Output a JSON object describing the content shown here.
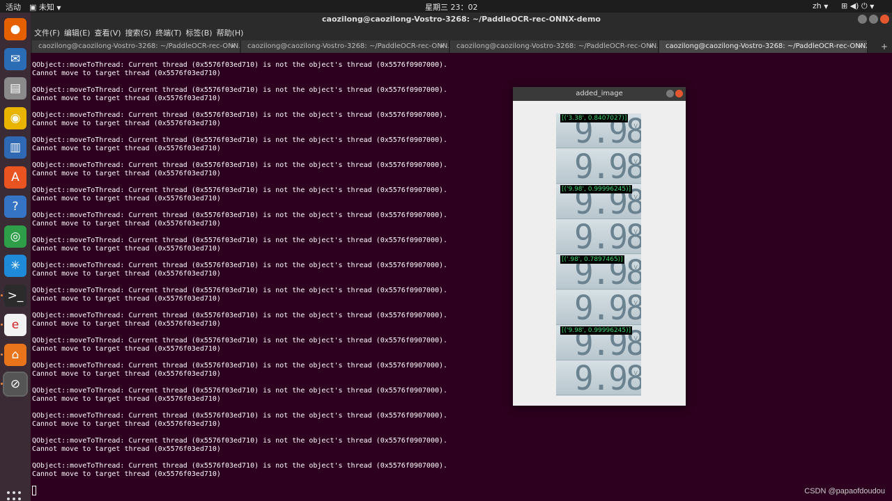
{
  "topbar": {
    "activities": "活动",
    "app_menu": "未知",
    "clock": "星期三 23：02",
    "lang": "zh"
  },
  "window": {
    "title": "caozilong@caozilong-Vostro-3268: ~/PaddleOCR-rec-ONNX-demo"
  },
  "menubar": [
    "文件(F)",
    "编辑(E)",
    "查看(V)",
    "搜索(S)",
    "终端(T)",
    "标签(B)",
    "帮助(H)"
  ],
  "tabs": [
    {
      "label": "caozilong@caozilong-Vostro-3268: ~/PaddleOCR-rec-ONN..."
    },
    {
      "label": "caozilong@caozilong-Vostro-3268: ~/PaddleOCR-rec-ONN..."
    },
    {
      "label": "caozilong@caozilong-Vostro-3268: ~/PaddleOCR-rec-ONN..."
    },
    {
      "label": "caozilong@caozilong-Vostro-3268: ~/PaddleOCR-rec-ONNX..."
    }
  ],
  "terminal": {
    "line1": "QObject::moveToThread: Current thread (0x5576f03ed710) is not the object's thread (0x5576f0907000).",
    "line2": "Cannot move to target thread (0x5576f03ed710)",
    "repeat_count": 17
  },
  "popup": {
    "title": "added_image",
    "strips": [
      {
        "digits": "9.98",
        "unit": "V",
        "label": "[('3.38', 0.8407027)]"
      },
      {
        "digits": "9.98",
        "unit": "V",
        "label": ""
      },
      {
        "digits": "9.98",
        "unit": "V",
        "label": "[('9.98', 0.99996245)]"
      },
      {
        "digits": "9.98",
        "unit": "V",
        "label": ""
      },
      {
        "digits": "9.98",
        "unit": "V",
        "label": "[('.98', 0.7897465)]"
      },
      {
        "digits": "9.98",
        "unit": "V",
        "label": ""
      },
      {
        "digits": "9.98",
        "unit": "V",
        "label": "[('9.98', 0.99996245)]"
      },
      {
        "digits": "9.98",
        "unit": "V",
        "label": ""
      }
    ]
  },
  "watermark": "CSDN @papaofdoudou",
  "colors": {
    "terminal_bg": "#2c001e",
    "ocr_text": "#3fd86a",
    "close_button": "#e3582e"
  },
  "dock_icons": [
    "firefox-icon",
    "thunderbird-icon",
    "files-icon",
    "rhythmbox-icon",
    "writer-icon",
    "software-center-icon",
    "help-icon",
    "chrome-icon",
    "settings-icon",
    "terminal-icon",
    "editor-icon",
    "app-icon",
    "screen-icon"
  ]
}
